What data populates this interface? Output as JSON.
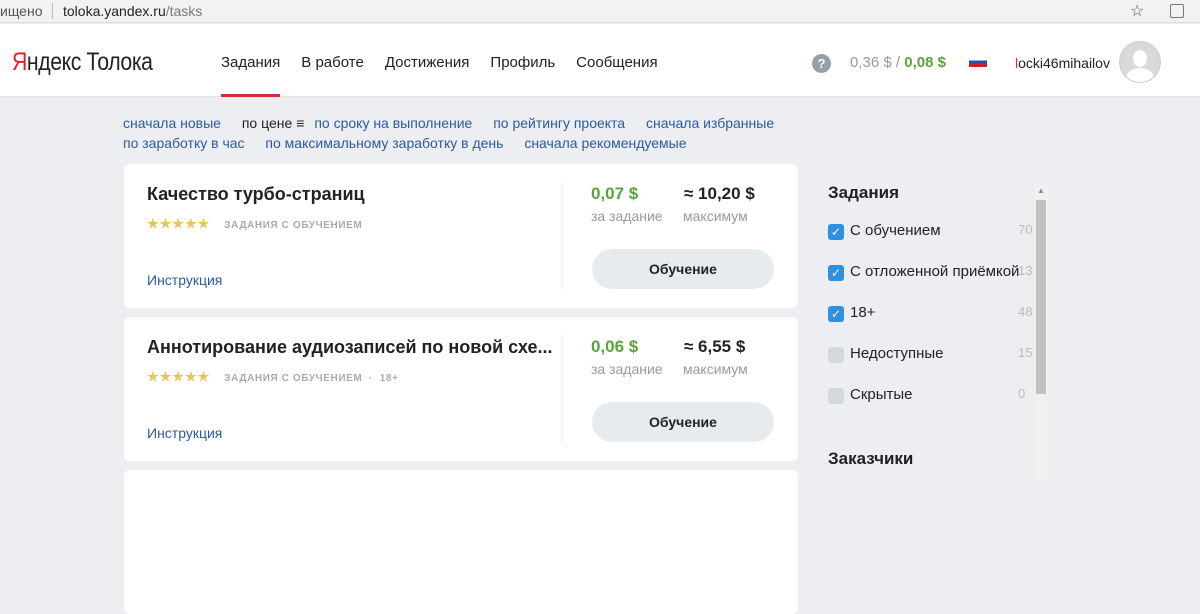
{
  "browser": {
    "security": "ищено",
    "url_host": "toloka.yandex.ru",
    "url_path": "/tasks"
  },
  "header": {
    "logo_ya": "Я",
    "logo_ndex": "ндекс",
    "logo_toloka": "Толока",
    "nav": [
      "Задания",
      "В работе",
      "Достижения",
      "Профиль",
      "Сообщения"
    ],
    "help": "?",
    "balance": "0,36 $",
    "balance_sep": " / ",
    "bonus": "0,08 $",
    "username_first": "l",
    "username_rest": "ocki46mihailov"
  },
  "sorts": [
    "сначала новые",
    "по цене",
    "по сроку на выполнение",
    "по рейтингу проекта",
    "сначала избранные",
    "по заработку в час",
    "по максимальному заработку в день",
    "сначала рекомендуемые"
  ],
  "tasks": [
    {
      "title": "Качество турбо-страниц",
      "rating": 4.5,
      "stars": "★★★★★",
      "tags": "ЗАДАНИЯ С ОБУЧЕНИЕМ",
      "price": "0,07 $",
      "price_label": "за задание",
      "max": "≈ 10,20 $",
      "max_label": "максимум",
      "instruction": "Инструкция",
      "button": "Обучение"
    },
    {
      "title": "Аннотирование аудиозаписей по новой схе...",
      "rating": 4.5,
      "stars": "★★★★★",
      "tags": "ЗАДАНИЯ С ОБУЧЕНИЕМ  ·  18+",
      "price": "0,06 $",
      "price_label": "за задание",
      "max": "≈ 6,55 $",
      "max_label": "максимум",
      "instruction": "Инструкция",
      "button": "Обучение"
    }
  ],
  "sidebar": {
    "title": "Задания",
    "filters": [
      {
        "label": "С обучением",
        "count": "70",
        "checked": true
      },
      {
        "label": "С отложенной приёмкой",
        "count": "13",
        "checked": true
      },
      {
        "label": "18+",
        "count": "48",
        "checked": true
      },
      {
        "label": "Недоступные",
        "count": "15",
        "checked": false
      },
      {
        "label": "Скрытые",
        "count": "0",
        "checked": false
      }
    ],
    "customers_title": "Заказчики"
  }
}
